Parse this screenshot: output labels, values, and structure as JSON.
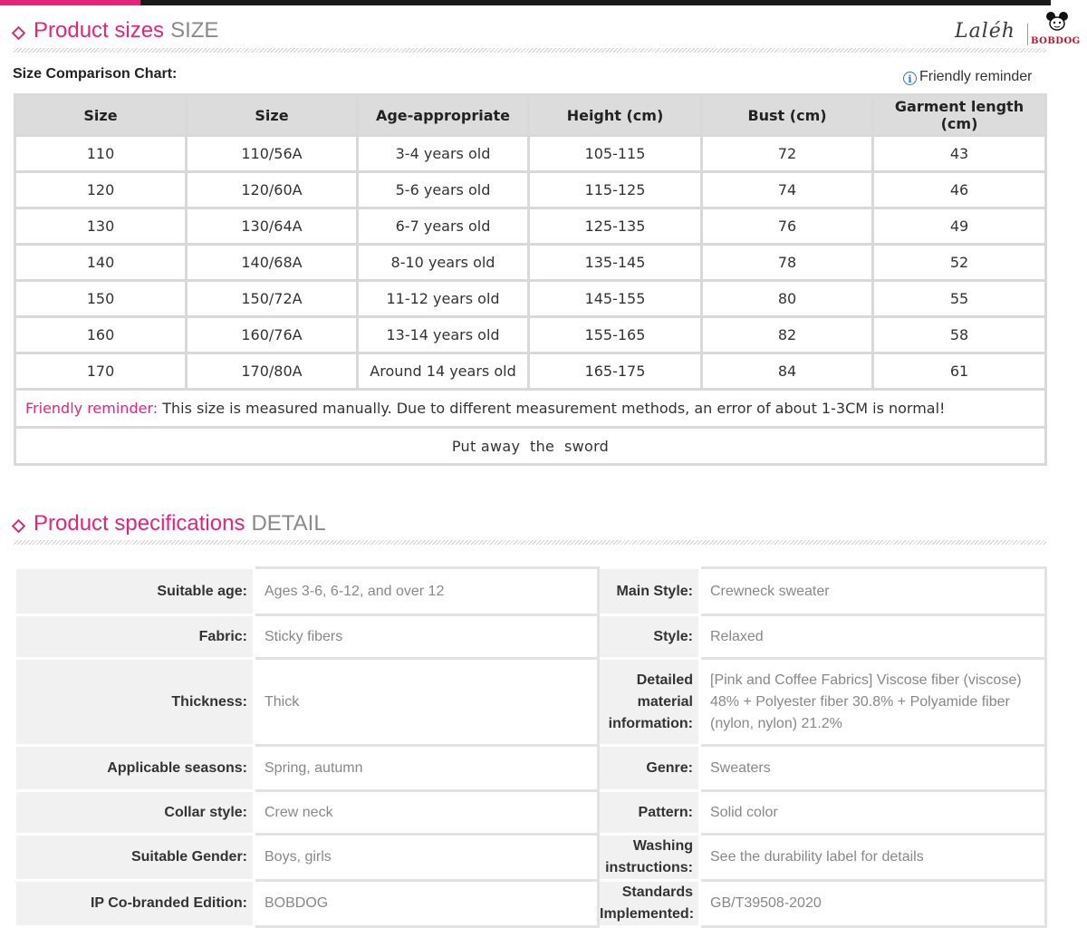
{
  "section1": {
    "title": "Product sizes",
    "title_en": "SIZE"
  },
  "logo": {
    "script": "Laléh",
    "brand": "BOBDOG"
  },
  "chart_label": "Size Comparison Chart:",
  "friendly_reminder_link": "Friendly reminder",
  "size_table": {
    "headers": [
      "Size",
      "Size",
      "Age-appropriate",
      "Height (cm)",
      "Bust (cm)",
      "Garment length (cm)"
    ],
    "rows": [
      [
        "110",
        "110/56A",
        "3-4 years old",
        "105-115",
        "72",
        "43"
      ],
      [
        "120",
        "120/60A",
        "5-6 years old",
        "115-125",
        "74",
        "46"
      ],
      [
        "130",
        "130/64A",
        "6-7 years old",
        "125-135",
        "76",
        "49"
      ],
      [
        "140",
        "140/68A",
        "8-10 years old",
        "135-145",
        "78",
        "52"
      ],
      [
        "150",
        "150/72A",
        "11-12 years old",
        "145-155",
        "80",
        "55"
      ],
      [
        "160",
        "160/76A",
        "13-14 years old",
        "155-165",
        "82",
        "58"
      ],
      [
        "170",
        "170/80A",
        "Around 14 years old",
        "165-175",
        "84",
        "61"
      ]
    ],
    "note_lead": "Friendly reminder:",
    "note_text": " This size is measured manually. Due to different measurement methods, an error of about 1-3CM is normal!",
    "footer": "Put away  the  sword"
  },
  "section2": {
    "title": "Product specifications",
    "title_en": "DETAIL"
  },
  "specs": [
    {
      "left_key": "Suitable age:",
      "left_val": "Ages 3-6, 6-12, and over 12",
      "right_key": "Main Style:",
      "right_val": "Crewneck sweater"
    },
    {
      "left_key": "Fabric:",
      "left_val": "Sticky fibers",
      "right_key": "Style:",
      "right_val": "Relaxed"
    },
    {
      "left_key": "Thickness:",
      "left_val": "Thick",
      "right_key": "Detailed material information:",
      "right_val": "[Pink and Coffee Fabrics] Viscose fiber (viscose) 48% + Polyester fiber 30.8% + Polyamide fiber (nylon, nylon) 21.2%"
    },
    {
      "left_key": "Applicable seasons:",
      "left_val": "Spring, autumn",
      "right_key": "Genre:",
      "right_val": "Sweaters"
    },
    {
      "left_key": "Collar style:",
      "left_val": "Crew neck",
      "right_key": "Pattern:",
      "right_val": "Solid color"
    },
    {
      "left_key": "Suitable Gender:",
      "left_val": "Boys, girls",
      "right_key": "Washing instructions:",
      "right_val": "See the durability label for details"
    },
    {
      "left_key": "IP Co-branded Edition:",
      "left_val": "BOBDOG",
      "right_key": "Standards Implemented:",
      "right_val": "GB/T39508-2020"
    }
  ]
}
